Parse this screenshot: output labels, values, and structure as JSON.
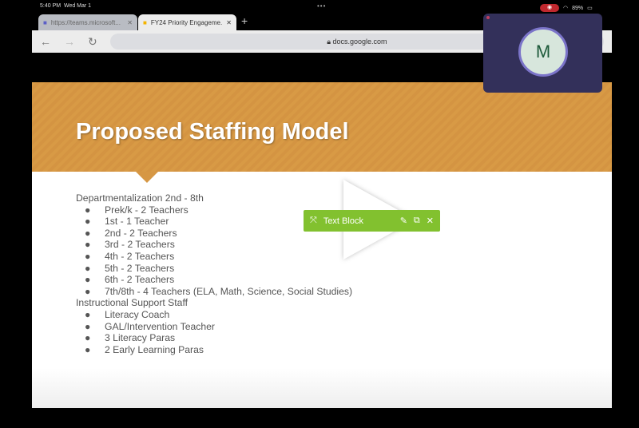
{
  "status": {
    "time": "5:40 PM",
    "date": "Wed Mar 1",
    "battery": "89%"
  },
  "tabs": [
    {
      "title": "https://teams.microsoft...",
      "icon": "teams-icon"
    },
    {
      "title": "FY24 Priority Engageme...",
      "icon": "slides-icon"
    }
  ],
  "address": "docs.google.com",
  "slide": {
    "title": "Proposed Staffing Model",
    "sections": [
      {
        "heading": "Departmentalization 2nd - 8th",
        "items": [
          "Prek/k - 2 Teachers",
          "1st - 1 Teacher",
          "2nd - 2 Teachers",
          "3rd - 2 Teachers",
          "4th - 2 Teachers",
          "5th - 2 Teachers",
          "6th - 2 Teachers",
          "7th/8th - 4 Teachers (ELA, Math, Science, Social Studies)"
        ]
      },
      {
        "heading": "Instructional Support Staff",
        "items": [
          "Literacy Coach",
          "GAL/Intervention Teacher",
          "3 Literacy Paras",
          "2 Early Learning Paras"
        ]
      }
    ]
  },
  "toolbar": {
    "label": "Text Block",
    "accent": "#82c12f"
  },
  "pip": {
    "initial": "M"
  }
}
